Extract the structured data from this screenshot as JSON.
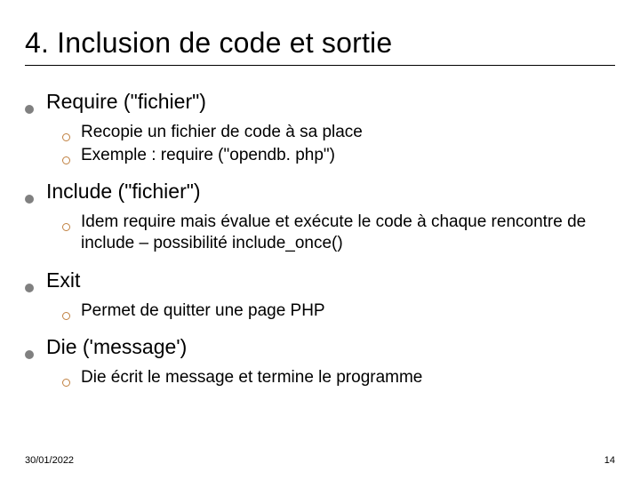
{
  "title": "4. Inclusion de code et sortie",
  "items": [
    {
      "label": "Require (\"fichier\")",
      "sub": [
        "Recopie un fichier de code à sa place",
        "Exemple : require (\"opendb. php\")"
      ]
    },
    {
      "label": "Include (\"fichier\")",
      "sub": [
        "Idem require mais évalue et exécute le code à chaque rencontre de include – possibilité include_once()"
      ]
    },
    {
      "label": "Exit",
      "sub": [
        "Permet de quitter une page PHP"
      ]
    },
    {
      "label": "Die ('message')",
      "sub": [
        "Die écrit le message et termine le programme"
      ]
    }
  ],
  "footer": {
    "date": "30/01/2022",
    "page": "14"
  }
}
